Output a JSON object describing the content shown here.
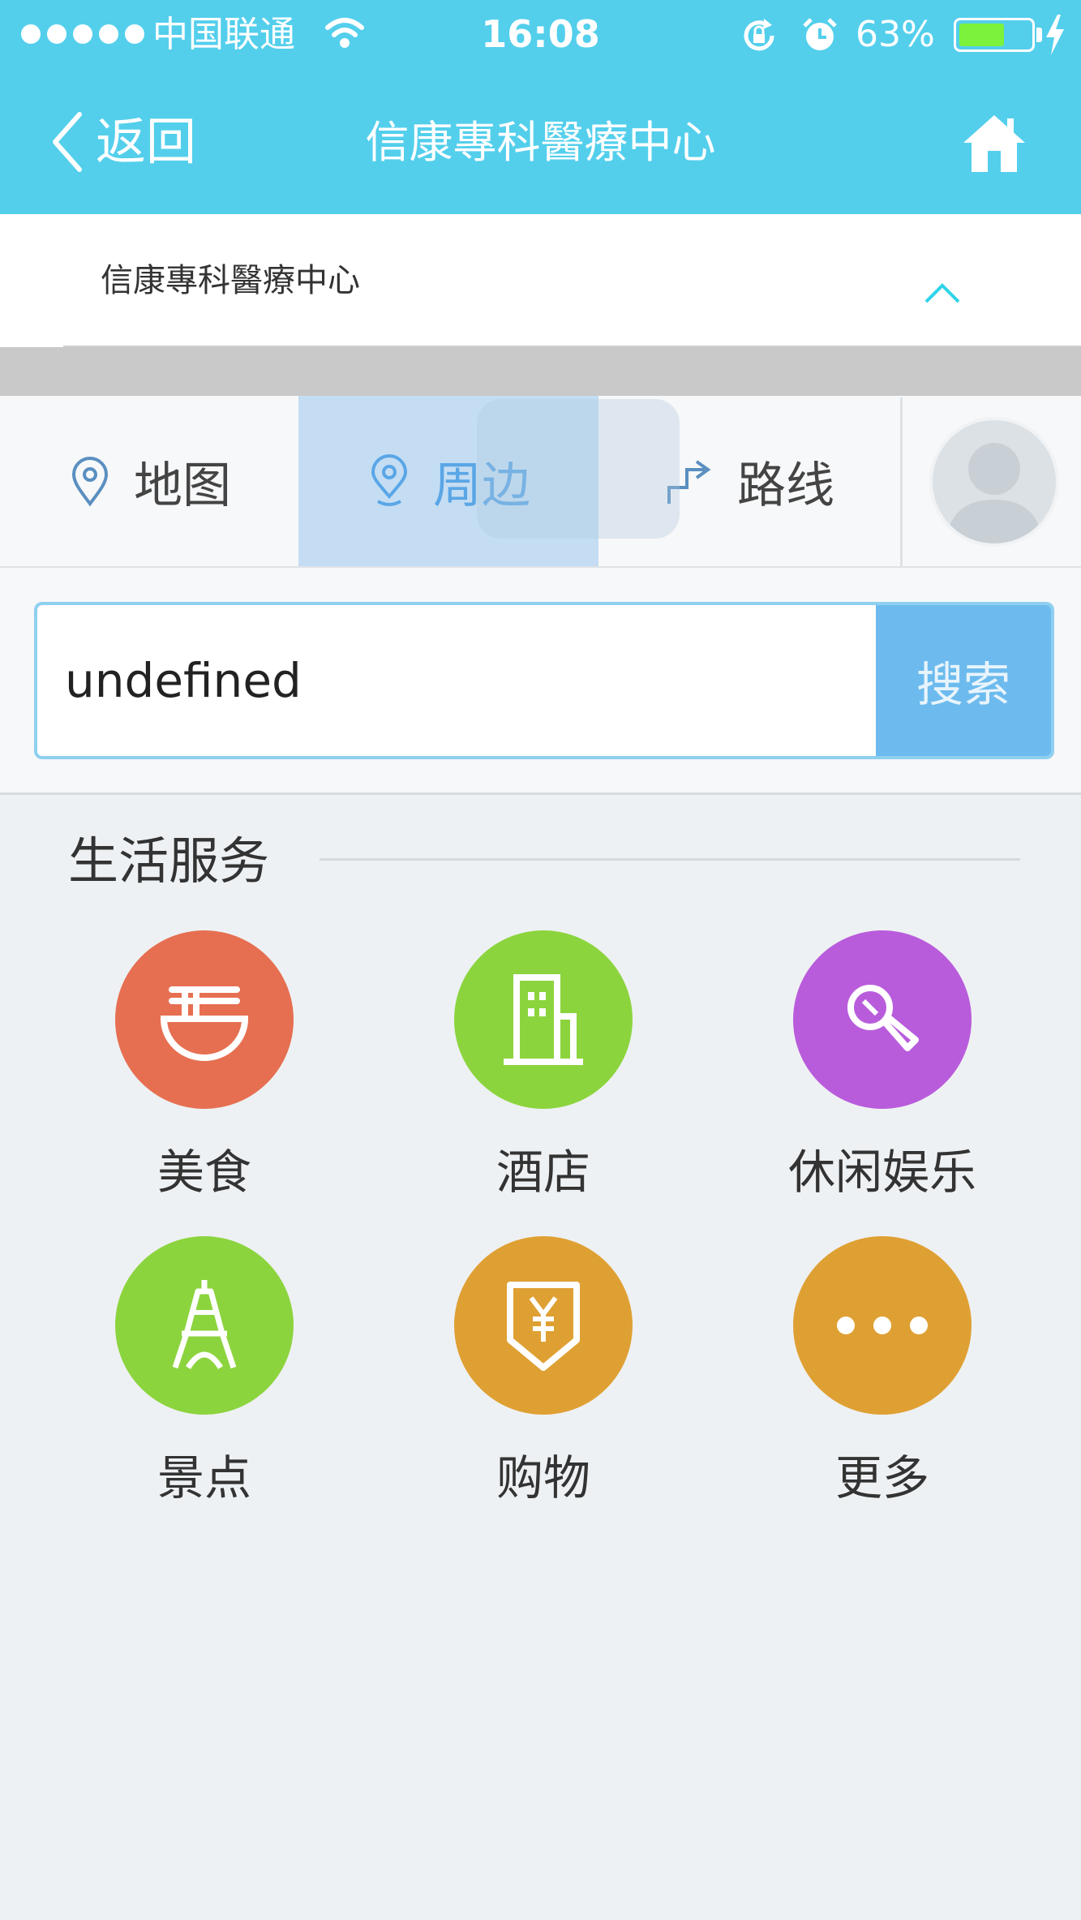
{
  "status_bar": {
    "carrier": "中国联通",
    "time": "16:08",
    "battery_percent": "63%",
    "battery_level": 0.63,
    "colors": {
      "battery_fill": "#7cf23c"
    }
  },
  "nav": {
    "back_label": "返回",
    "title": "信康專科醫療中心",
    "icons": [
      "chevron-left-icon",
      "home-icon"
    ]
  },
  "place_header": {
    "name": "信康專科醫療中心",
    "toggle_icon": "chevron-up-icon"
  },
  "tabs": [
    {
      "label": "地图",
      "icon": "location-pin-icon",
      "selected": false
    },
    {
      "label": "周边",
      "icon": "location-pin-icon",
      "selected": true
    },
    {
      "label": "路线",
      "icon": "route-arrow-icon",
      "selected": false
    }
  ],
  "search": {
    "value": "undefined",
    "button_label": "搜索"
  },
  "services": {
    "title": "生活服务",
    "items": [
      {
        "label": "美食",
        "icon": "noodle-bowl-icon",
        "color": "#e66f51"
      },
      {
        "label": "酒店",
        "icon": "building-icon",
        "color": "#8cd43e"
      },
      {
        "label": "休闲娱乐",
        "icon": "microphone-icon",
        "color": "#b95cdc"
      },
      {
        "label": "景点",
        "icon": "tower-icon",
        "color": "#8cd43e"
      },
      {
        "label": "购物",
        "icon": "yen-tag-icon",
        "color": "#dfa033"
      },
      {
        "label": "更多",
        "icon": "more-dots-icon",
        "color": "#dfa033"
      }
    ]
  }
}
